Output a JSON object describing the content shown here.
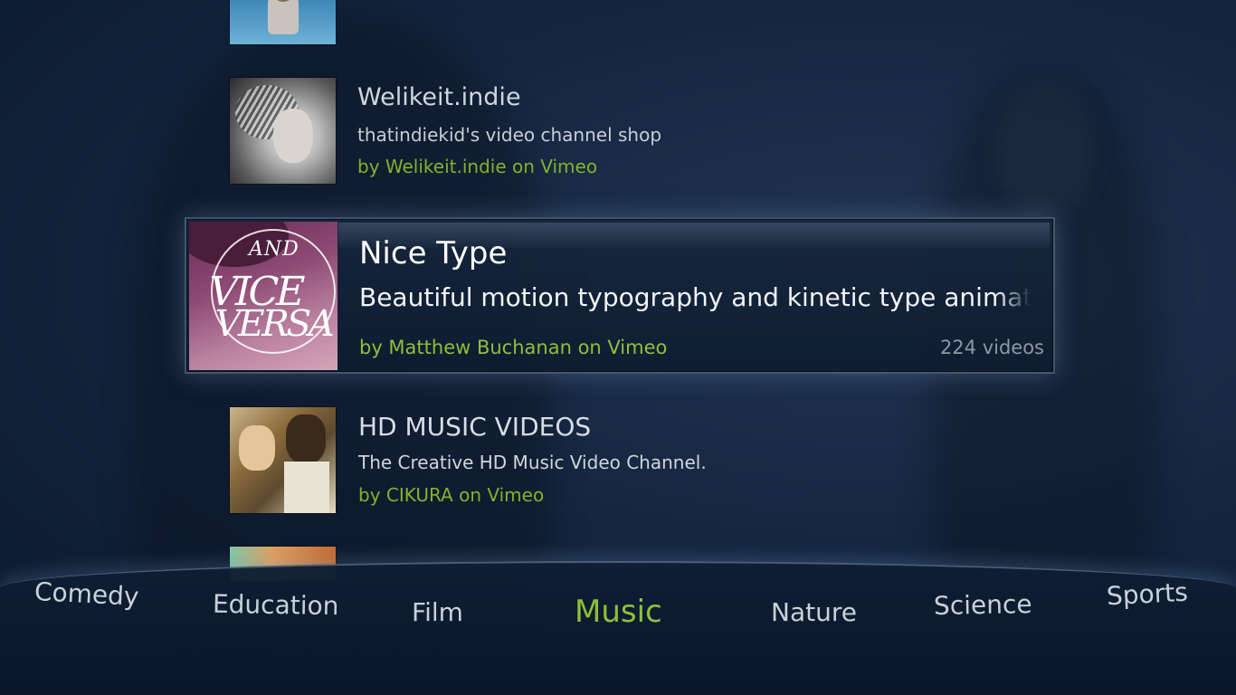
{
  "channels": [
    {
      "title": "Welikeit.indie",
      "description": "thatindiekid's video channel shop",
      "author": "by Welikeit.indie on Vimeo"
    },
    {
      "title": "Nice Type",
      "description": "Beautiful motion typography and kinetic type animation",
      "author": "by Matthew Buchanan on Vimeo",
      "video_count": "224 videos",
      "thumb_text": {
        "and": "AND",
        "vice": "VICE",
        "versa": "VERSA"
      }
    },
    {
      "title": "HD MUSIC VIDEOS",
      "description": "The Creative HD Music Video Channel.",
      "author": "by CIKURA on Vimeo"
    }
  ],
  "categories": [
    "Comedy",
    "Education",
    "Film",
    "Music",
    "Nature",
    "Science",
    "Sports"
  ],
  "selected_category": "Music",
  "colors": {
    "accent": "#8dc03a",
    "background": "#142640",
    "text": "#d8dde3",
    "muted": "#8e98a3"
  }
}
